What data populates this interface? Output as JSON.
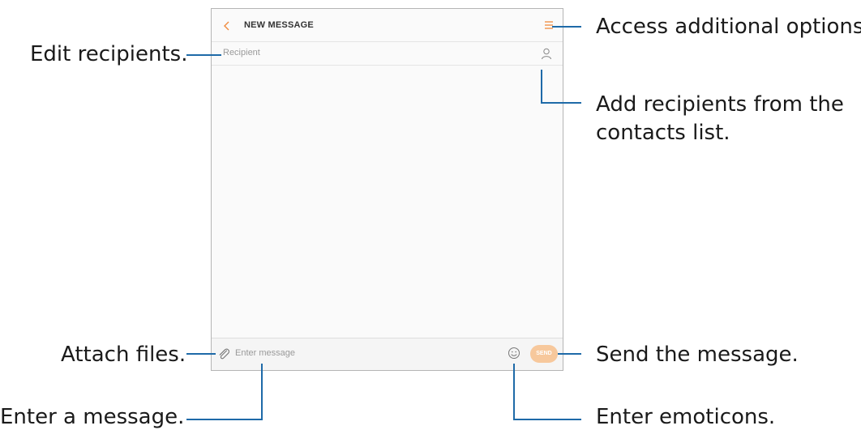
{
  "app": {
    "title": "NEW MESSAGE",
    "recipient_placeholder": "Recipient",
    "message_placeholder": "Enter message",
    "send_label": "SEND"
  },
  "callouts": {
    "options": "Access additional options.",
    "edit_recipients": "Edit recipients.",
    "add_contacts_line1": "Add recipients from the",
    "add_contacts_line2": "contacts list.",
    "attach": "Attach files.",
    "send": "Send the message.",
    "enter_message": "Enter a message.",
    "emoticons": "Enter emoticons."
  },
  "colors": {
    "accent": "#f08a3c",
    "send_button": "#f7c89c",
    "callout_line": "#1e6aa8"
  },
  "icons": [
    "back-arrow-icon",
    "menu-icon",
    "contact-icon",
    "paperclip-icon",
    "emoji-icon"
  ]
}
